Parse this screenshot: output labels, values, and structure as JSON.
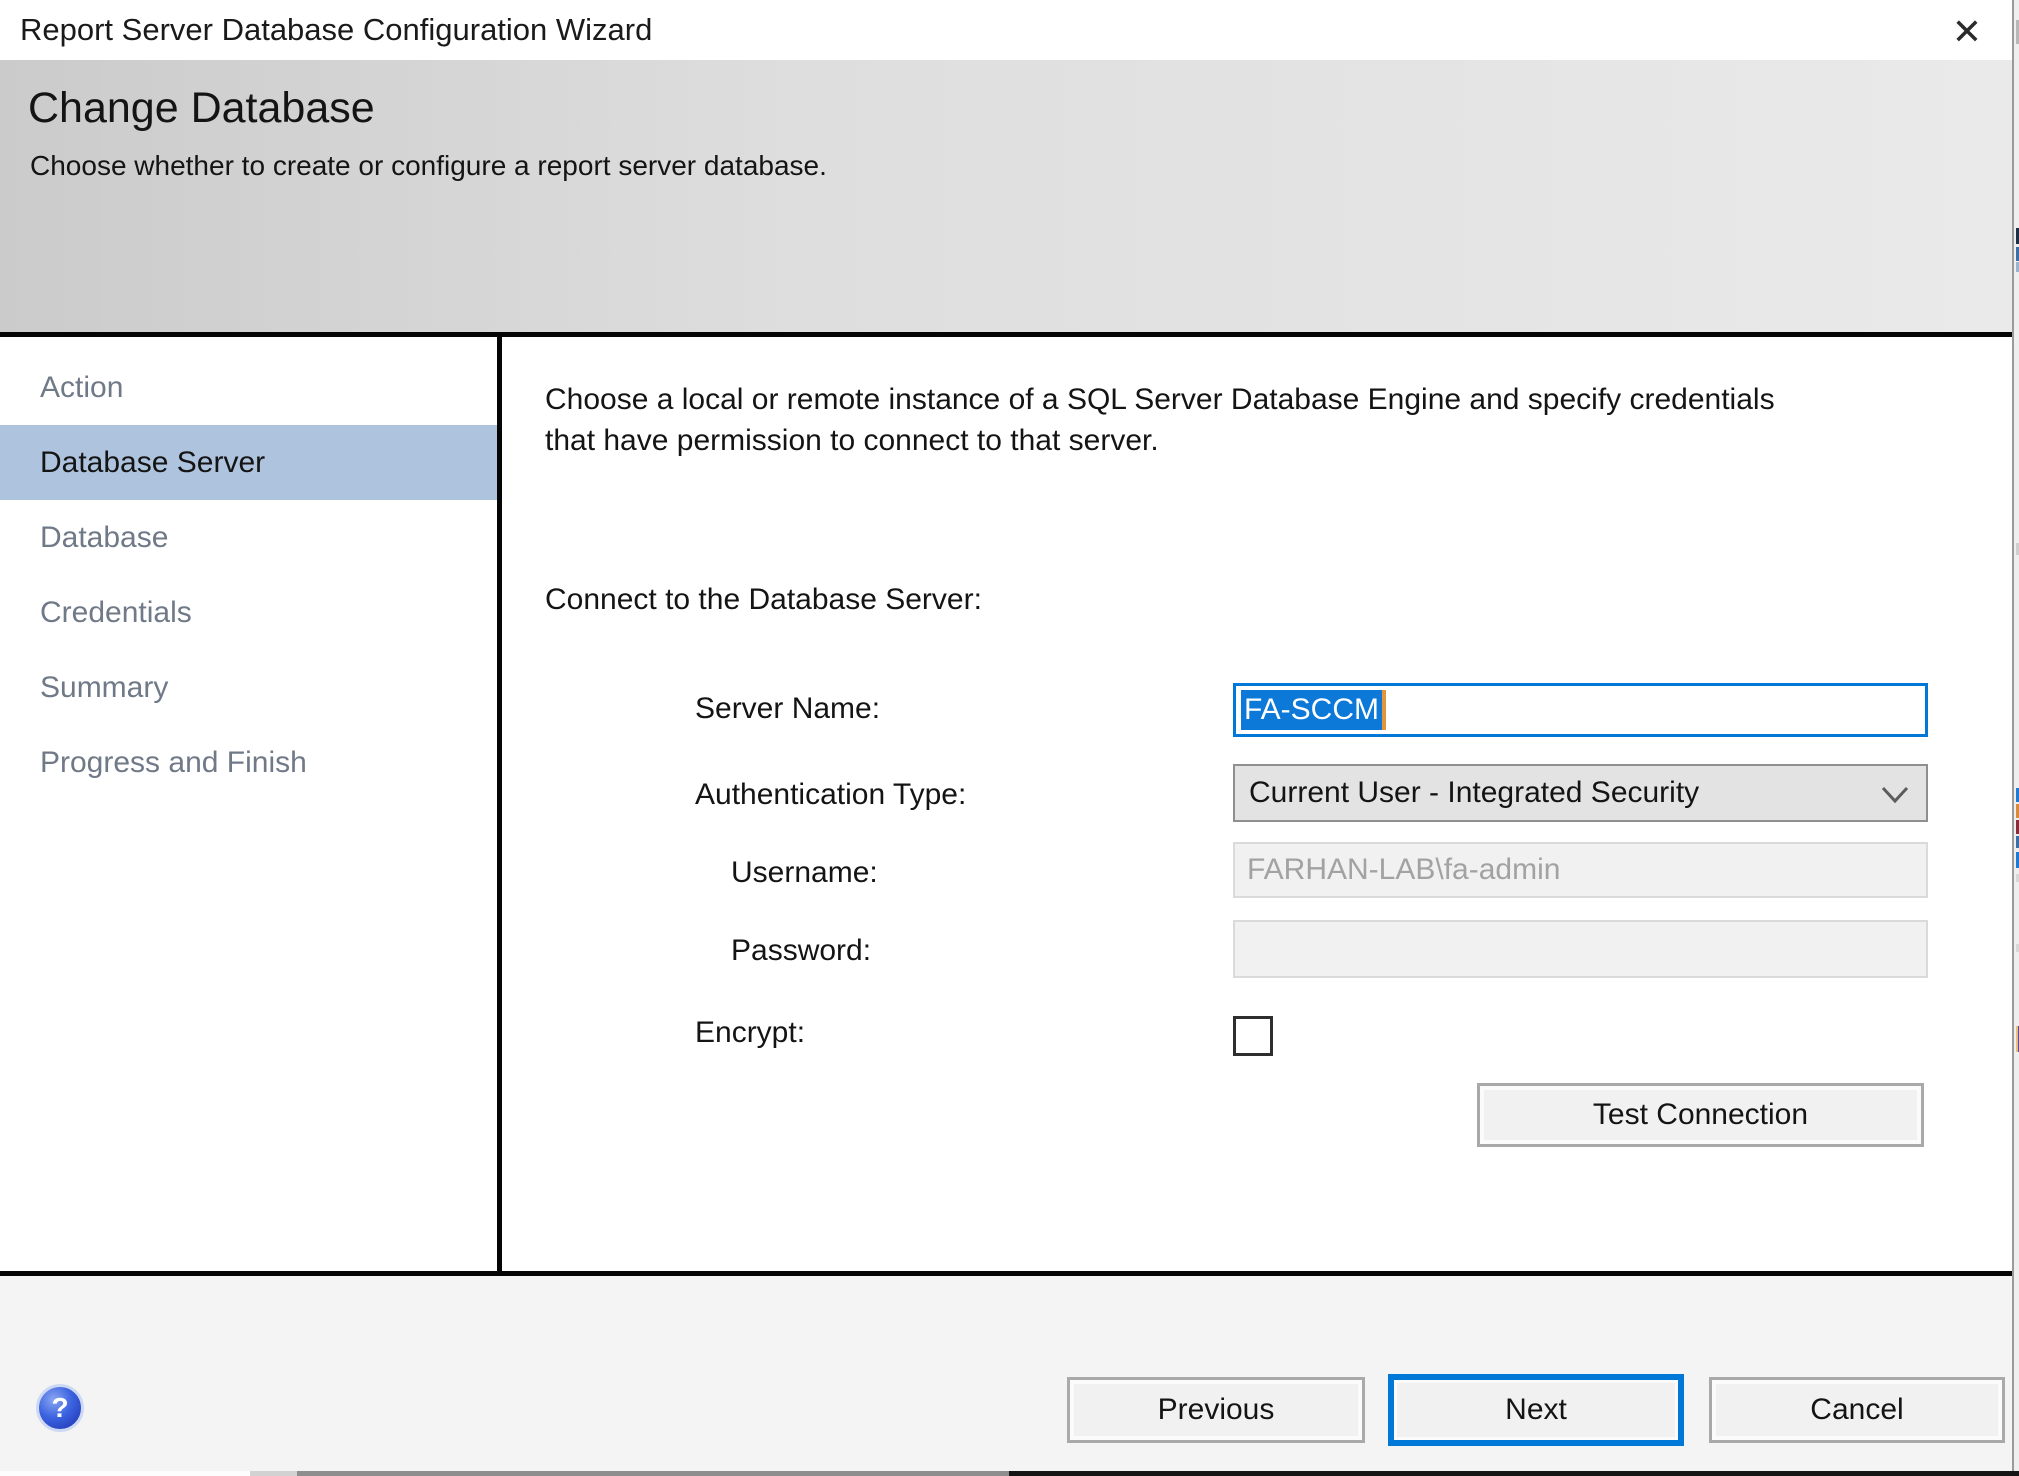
{
  "window": {
    "title": "Report Server Database Configuration Wizard",
    "close_icon": "✕"
  },
  "header": {
    "title": "Change Database",
    "subtitle": "Choose whether to create or configure a report server database."
  },
  "sidebar": {
    "items": [
      {
        "label": "Action",
        "selected": false
      },
      {
        "label": "Database Server",
        "selected": true
      },
      {
        "label": "Database",
        "selected": false
      },
      {
        "label": "Credentials",
        "selected": false
      },
      {
        "label": "Summary",
        "selected": false
      },
      {
        "label": "Progress and Finish",
        "selected": false
      }
    ]
  },
  "main": {
    "intro": "Choose a local or remote instance of a SQL Server Database Engine and specify credentials that have permission to connect to that server.",
    "section_label": "Connect to the Database Server:",
    "server_name": {
      "label": "Server Name:",
      "value": "FA-SCCM",
      "state": "focused, text selected"
    },
    "auth_type": {
      "label": "Authentication Type:",
      "value": "Current User - Integrated Security"
    },
    "username": {
      "label": "Username:",
      "value": "FARHAN-LAB\\fa-admin",
      "disabled": true
    },
    "password": {
      "label": "Password:",
      "value": "",
      "disabled": true
    },
    "encrypt": {
      "label": "Encrypt:",
      "checked": false
    },
    "test_connection": {
      "label": "Test Connection"
    }
  },
  "footer": {
    "help_icon": "?",
    "buttons": [
      {
        "label": "Previous",
        "default": false
      },
      {
        "label": "Next",
        "default": true
      },
      {
        "label": "Cancel",
        "default": false
      }
    ]
  },
  "colors": {
    "accent": "#0078d7",
    "selection_background": "#0c79d8",
    "caret": "#e2953f",
    "sidebar_highlight": "#aec4de",
    "header_gradient_left": "#cbcbcb",
    "header_gradient_right": "#eaeaea",
    "footer_background": "#f4f4f4",
    "disabled_field_background": "#f1f1f1",
    "disabled_text": "#a2a2a2"
  }
}
